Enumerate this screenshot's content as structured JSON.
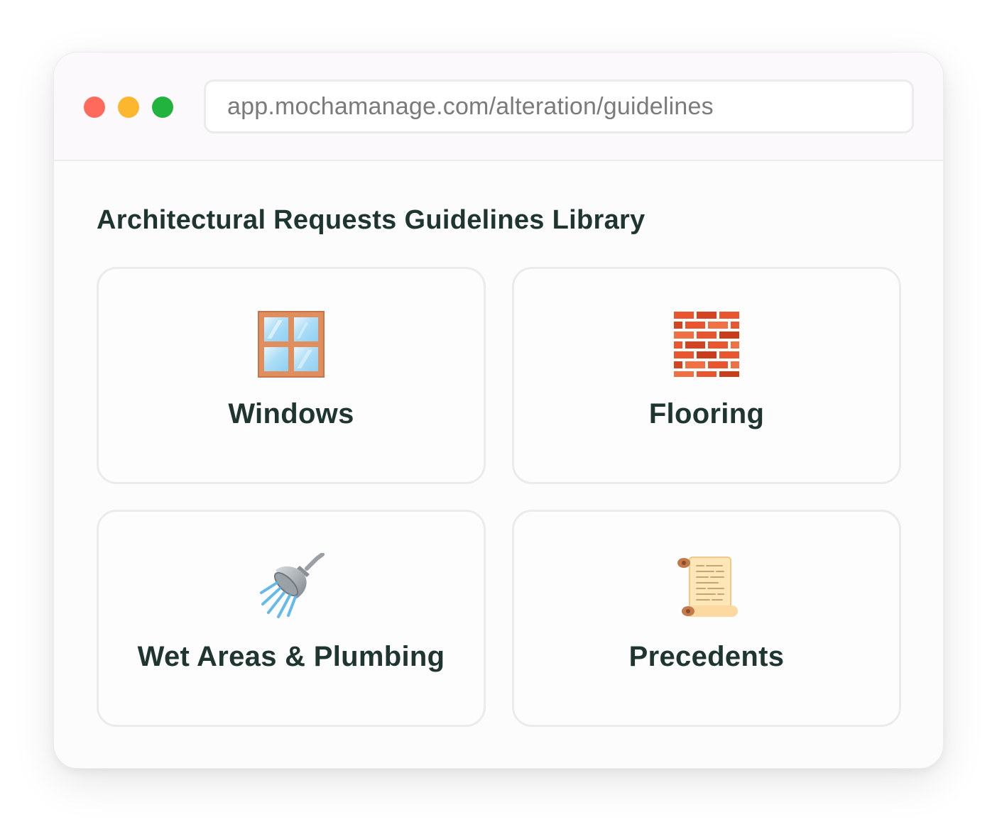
{
  "browser": {
    "url": "app.mochamanage.com/alteration/guidelines",
    "colors": {
      "close": "#fe6b5c",
      "minimize": "#fdb72e",
      "maximize": "#21b33e"
    }
  },
  "page": {
    "title": "Architectural Requests Guidelines Library"
  },
  "cards": [
    {
      "label": "Windows",
      "icon": "window-icon"
    },
    {
      "label": "Flooring",
      "icon": "brick-icon"
    },
    {
      "label": "Wet Areas & Plumbing",
      "icon": "shower-icon"
    },
    {
      "label": "Precedents",
      "icon": "scroll-icon"
    }
  ],
  "theme": {
    "text": "#1e3530",
    "card_border": "#ebebeb"
  }
}
